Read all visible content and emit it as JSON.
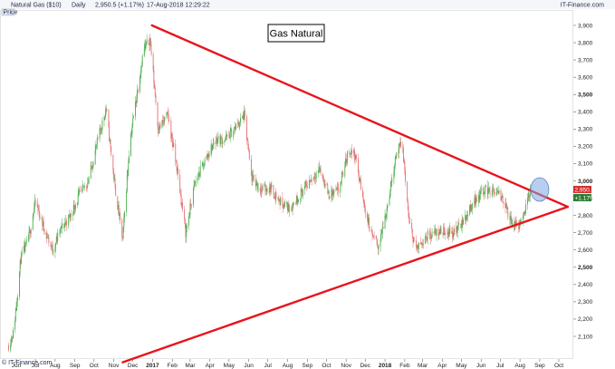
{
  "header": {
    "instrument": "Natural Gas ($10)",
    "period": "Daily",
    "last_value": "2,950.5 (+1.17%)",
    "timestamp": "17-Aug-2018 12:29:22",
    "source": "IT-Finance.com",
    "axis_tag": "Price"
  },
  "footer": {
    "copyright": "© IT-Finance.com"
  },
  "colors": {
    "up": "#4caf50",
    "down": "#e57373",
    "trend": "#e8141c",
    "highlight": "#7ea6e0",
    "price_tag": "#d32f2f",
    "change_tag": "#2e7d32"
  },
  "chart_data": {
    "type": "candlestick",
    "title": "Gas Natural",
    "ylim": [
      1950,
      4000
    ],
    "y_ticks": [
      2100,
      2200,
      2300,
      2400,
      2500,
      2600,
      2700,
      2800,
      2900,
      3000,
      3100,
      3200,
      3300,
      3400,
      3500,
      3600,
      3700,
      3800,
      3900
    ],
    "y_tick_labels": [
      "2,100",
      "2,200",
      "2,300",
      "2,400",
      "2,500",
      "2,600",
      "2,700",
      "2,800",
      "2,900",
      "3,000",
      "3,100",
      "3,200",
      "3,300",
      "3,400",
      "3,500",
      "3,600",
      "3,700",
      "3,800",
      "3,900"
    ],
    "x_labels": [
      {
        "label": "Jun",
        "date": "2016-06-01"
      },
      {
        "label": "Jul",
        "date": "2016-07-01"
      },
      {
        "label": "Aug",
        "date": "2016-08-01"
      },
      {
        "label": "Sep",
        "date": "2016-09-01"
      },
      {
        "label": "Oct",
        "date": "2016-10-01"
      },
      {
        "label": "Nov",
        "date": "2016-11-01"
      },
      {
        "label": "Dec",
        "date": "2016-12-01"
      },
      {
        "label": "2017",
        "date": "2017-01-01",
        "bold": true
      },
      {
        "label": "Feb",
        "date": "2017-02-01"
      },
      {
        "label": "Mar",
        "date": "2017-03-01"
      },
      {
        "label": "Apr",
        "date": "2017-04-01"
      },
      {
        "label": "May",
        "date": "2017-05-01"
      },
      {
        "label": "Jun",
        "date": "2017-06-01"
      },
      {
        "label": "Jul",
        "date": "2017-07-01"
      },
      {
        "label": "Aug",
        "date": "2017-08-01"
      },
      {
        "label": "Sep",
        "date": "2017-09-01"
      },
      {
        "label": "Oct",
        "date": "2017-10-01"
      },
      {
        "label": "Nov",
        "date": "2017-11-01"
      },
      {
        "label": "Dec",
        "date": "2017-12-01"
      },
      {
        "label": "2018",
        "date": "2018-01-01",
        "bold": true
      },
      {
        "label": "Feb",
        "date": "2018-02-01"
      },
      {
        "label": "Mar",
        "date": "2018-03-01"
      },
      {
        "label": "Apr",
        "date": "2018-04-01"
      },
      {
        "label": "May",
        "date": "2018-05-01"
      },
      {
        "label": "Jun",
        "date": "2018-06-01"
      },
      {
        "label": "Jul",
        "date": "2018-07-01"
      },
      {
        "label": "Aug",
        "date": "2018-08-01"
      },
      {
        "label": "Sep",
        "date": "2018-09-01"
      },
      {
        "label": "Oct",
        "date": "2018-10-01"
      }
    ],
    "price_path": [
      {
        "date": "2016-05-20",
        "value": 2050
      },
      {
        "date": "2016-05-28",
        "value": 2130
      },
      {
        "date": "2016-06-08",
        "value": 2550
      },
      {
        "date": "2016-06-20",
        "value": 2660
      },
      {
        "date": "2016-07-01",
        "value": 2880
      },
      {
        "date": "2016-07-15",
        "value": 2720
      },
      {
        "date": "2016-07-28",
        "value": 2600
      },
      {
        "date": "2016-08-10",
        "value": 2720
      },
      {
        "date": "2016-08-25",
        "value": 2800
      },
      {
        "date": "2016-09-08",
        "value": 2920
      },
      {
        "date": "2016-09-22",
        "value": 3000
      },
      {
        "date": "2016-10-08",
        "value": 3250
      },
      {
        "date": "2016-10-20",
        "value": 3420
      },
      {
        "date": "2016-11-03",
        "value": 2960
      },
      {
        "date": "2016-11-15",
        "value": 2660
      },
      {
        "date": "2016-11-26",
        "value": 3220
      },
      {
        "date": "2016-12-08",
        "value": 3520
      },
      {
        "date": "2016-12-18",
        "value": 3760
      },
      {
        "date": "2016-12-28",
        "value": 3820
      },
      {
        "date": "2017-01-10",
        "value": 3300
      },
      {
        "date": "2017-01-25",
        "value": 3380
      },
      {
        "date": "2017-02-08",
        "value": 3080
      },
      {
        "date": "2017-02-22",
        "value": 2700
      },
      {
        "date": "2017-03-08",
        "value": 2980
      },
      {
        "date": "2017-03-22",
        "value": 3100
      },
      {
        "date": "2017-04-10",
        "value": 3240
      },
      {
        "date": "2017-04-25",
        "value": 3240
      },
      {
        "date": "2017-05-10",
        "value": 3300
      },
      {
        "date": "2017-05-25",
        "value": 3380
      },
      {
        "date": "2017-06-05",
        "value": 3020
      },
      {
        "date": "2017-06-20",
        "value": 2950
      },
      {
        "date": "2017-07-05",
        "value": 2960
      },
      {
        "date": "2017-07-20",
        "value": 2880
      },
      {
        "date": "2017-08-05",
        "value": 2840
      },
      {
        "date": "2017-08-20",
        "value": 2920
      },
      {
        "date": "2017-09-05",
        "value": 3000
      },
      {
        "date": "2017-09-20",
        "value": 3070
      },
      {
        "date": "2017-10-05",
        "value": 2920
      },
      {
        "date": "2017-10-20",
        "value": 2940
      },
      {
        "date": "2017-11-05",
        "value": 3180
      },
      {
        "date": "2017-11-15",
        "value": 3150
      },
      {
        "date": "2017-11-28",
        "value": 2880
      },
      {
        "date": "2017-12-10",
        "value": 2700
      },
      {
        "date": "2017-12-22",
        "value": 2620
      },
      {
        "date": "2018-01-05",
        "value": 2860
      },
      {
        "date": "2018-01-18",
        "value": 3150
      },
      {
        "date": "2018-01-28",
        "value": 3220
      },
      {
        "date": "2018-02-08",
        "value": 2750
      },
      {
        "date": "2018-02-20",
        "value": 2600
      },
      {
        "date": "2018-03-05",
        "value": 2680
      },
      {
        "date": "2018-03-20",
        "value": 2700
      },
      {
        "date": "2018-04-05",
        "value": 2710
      },
      {
        "date": "2018-04-20",
        "value": 2700
      },
      {
        "date": "2018-05-05",
        "value": 2770
      },
      {
        "date": "2018-05-20",
        "value": 2880
      },
      {
        "date": "2018-06-05",
        "value": 2950
      },
      {
        "date": "2018-06-20",
        "value": 2940
      },
      {
        "date": "2018-07-05",
        "value": 2900
      },
      {
        "date": "2018-07-18",
        "value": 2760
      },
      {
        "date": "2018-07-28",
        "value": 2730
      },
      {
        "date": "2018-08-08",
        "value": 2820
      },
      {
        "date": "2018-08-17",
        "value": 2950
      }
    ],
    "trendlines": [
      {
        "name": "upper",
        "from": {
          "date": "2016-12-31",
          "value": 3900
        },
        "to": {
          "date": "2018-10-15",
          "value": 2850
        }
      },
      {
        "name": "lower",
        "from": {
          "date": "2016-11-15",
          "value": 1950
        },
        "to": {
          "date": "2018-10-15",
          "value": 2850
        }
      }
    ],
    "highlight": {
      "date": "2018-09-01",
      "value": 2950
    },
    "last_price_tag": "2,950.5",
    "change_tag": "+1.17%"
  }
}
